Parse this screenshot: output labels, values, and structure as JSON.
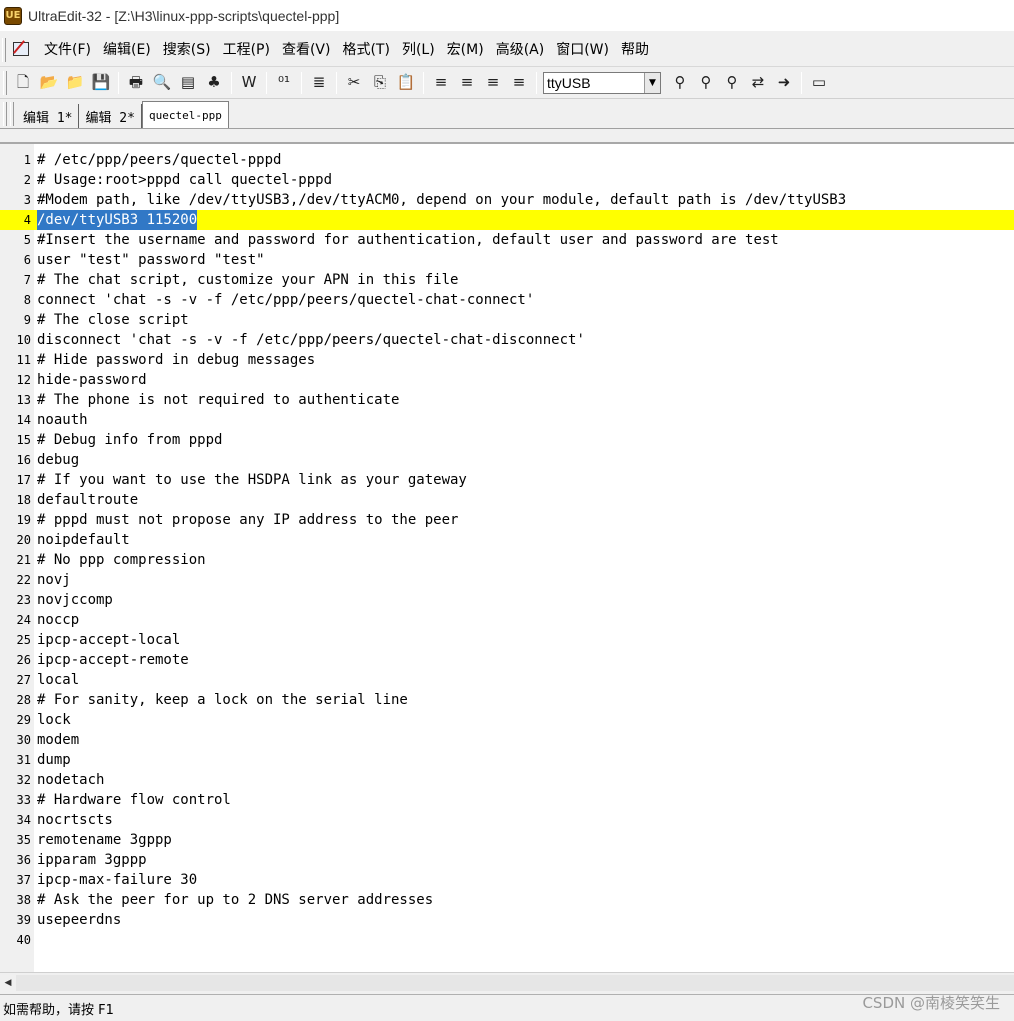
{
  "window": {
    "title": "UltraEdit-32 - [Z:\\H3\\linux-ppp-scripts\\quectel-ppp]",
    "app_icon_text": "UE"
  },
  "menu": [
    {
      "id": "file",
      "label": "文件(F)"
    },
    {
      "id": "edit",
      "label": "编辑(E)"
    },
    {
      "id": "search",
      "label": "搜索(S)"
    },
    {
      "id": "project",
      "label": "工程(P)"
    },
    {
      "id": "view",
      "label": "查看(V)"
    },
    {
      "id": "format",
      "label": "格式(T)"
    },
    {
      "id": "column",
      "label": "列(L)"
    },
    {
      "id": "macro",
      "label": "宏(M)"
    },
    {
      "id": "advanced",
      "label": "高级(A)"
    },
    {
      "id": "window",
      "label": "窗口(W)"
    },
    {
      "id": "help",
      "label": "帮助"
    }
  ],
  "toolbar": {
    "search_combo_value": "ttyUSB",
    "buttons": [
      {
        "name": "new-file-icon",
        "glyph": "🗋"
      },
      {
        "name": "open-folder-icon",
        "glyph": "📂"
      },
      {
        "name": "open-recent-icon",
        "glyph": "📁"
      },
      {
        "name": "save-icon",
        "glyph": "💾"
      },
      {
        "name": "print-icon",
        "glyph": "🖶"
      },
      {
        "name": "print-preview-icon",
        "glyph": "🔍"
      },
      {
        "name": "column-mode-icon",
        "glyph": "▤"
      },
      {
        "name": "ftp-icon",
        "glyph": "♣"
      },
      {
        "name": "word-wrap-icon",
        "glyph": "W"
      },
      {
        "name": "hex-mode-icon",
        "glyph": "⁰¹"
      },
      {
        "name": "line-numbers-icon",
        "glyph": "≣"
      },
      {
        "name": "cut-icon",
        "glyph": "✂"
      },
      {
        "name": "copy-icon",
        "glyph": "⎘"
      },
      {
        "name": "paste-icon",
        "glyph": "📋"
      },
      {
        "name": "align-left-icon",
        "glyph": "≡"
      },
      {
        "name": "align-center-icon",
        "glyph": "≡"
      },
      {
        "name": "align-right-icon",
        "glyph": "≡"
      },
      {
        "name": "justify-icon",
        "glyph": "≡"
      },
      {
        "name": "find-icon",
        "glyph": "⚲"
      },
      {
        "name": "find-prev-icon",
        "glyph": "⚲"
      },
      {
        "name": "find-next-icon",
        "glyph": "⚲"
      },
      {
        "name": "replace-icon",
        "glyph": "⇄"
      },
      {
        "name": "goto-icon",
        "glyph": "➜"
      },
      {
        "name": "window-icon",
        "glyph": "▭"
      }
    ]
  },
  "tabs": [
    {
      "label": "编辑 1*",
      "active": false
    },
    {
      "label": "编辑 2*",
      "active": false
    },
    {
      "label": "quectel-ppp",
      "active": true
    }
  ],
  "editor": {
    "current_line": 4,
    "lines": [
      "# /etc/ppp/peers/quectel-pppd",
      "# Usage:root>pppd call quectel-pppd",
      "#Modem path, like /dev/ttyUSB3,/dev/ttyACM0, depend on your module, default path is /dev/ttyUSB3",
      "/dev/ttyUSB3 115200",
      "#Insert the username and password for authentication, default user and password are test",
      "user \"test\" password \"test\"",
      "# The chat script, customize your APN in this file",
      "connect 'chat -s -v -f /etc/ppp/peers/quectel-chat-connect'",
      "# The close script",
      "disconnect 'chat -s -v -f /etc/ppp/peers/quectel-chat-disconnect'",
      "# Hide password in debug messages",
      "hide-password",
      "# The phone is not required to authenticate",
      "noauth",
      "# Debug info from pppd",
      "debug",
      "# If you want to use the HSDPA link as your gateway",
      "defaultroute",
      "# pppd must not propose any IP address to the peer",
      "noipdefault",
      "# No ppp compression",
      "novj",
      "novjccomp",
      "noccp",
      "ipcp-accept-local",
      "ipcp-accept-remote",
      "local",
      "# For sanity, keep a lock on the serial line",
      "lock",
      "modem",
      "dump",
      "nodetach",
      "# Hardware flow control",
      "nocrtscts",
      "remotename 3gppp",
      "ipparam 3gppp",
      "ipcp-max-failure 30",
      "# Ask the peer for up to 2 DNS server addresses",
      "usepeerdns",
      ""
    ]
  },
  "status": {
    "text": "如需帮助，请按 F1",
    "watermark": "CSDN @南棱笑笑生"
  },
  "colors": {
    "current_line_bg": "#ffff00",
    "selection_bg": "#3178c6",
    "selection_fg": "#ffffff"
  }
}
